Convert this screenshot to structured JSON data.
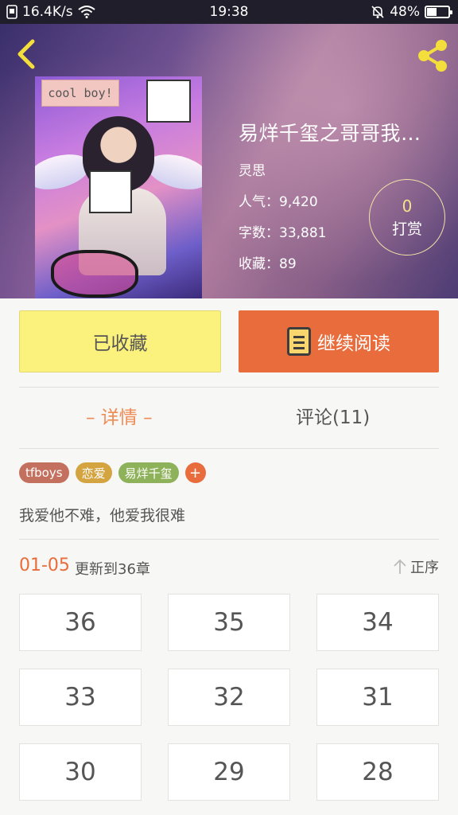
{
  "status_bar": {
    "speed": "16.4K/s",
    "time": "19:38",
    "battery": "48%",
    "battery_level": 0.48
  },
  "book": {
    "title": "易烊千玺之哥哥我…",
    "author": "灵思",
    "popularity_label": "人气：",
    "popularity": "9,420",
    "words_label": "字数：",
    "words": "33,881",
    "favorites_label": "收藏：",
    "favorites": "89",
    "cover_text": "cool boy!",
    "reward_count": "0",
    "reward_label": "打赏"
  },
  "actions": {
    "collected_label": "已收藏",
    "continue_label": "继续阅读"
  },
  "tabs": [
    {
      "label": "– 详情 –",
      "active": true
    },
    {
      "label": "评论(11)",
      "active": false
    }
  ],
  "tags": [
    {
      "label": "tfboys",
      "color": "#c4705e"
    },
    {
      "label": "恋爱",
      "color": "#d4a441"
    },
    {
      "label": "易烊千玺",
      "color": "#8eb25a"
    }
  ],
  "tag_add_label": "+",
  "synopsis": "我爱他不难，他爱我很难",
  "chapters": {
    "range": "01-05",
    "update": "更新到36章",
    "sort_label": "正序",
    "items": [
      "36",
      "35",
      "34",
      "33",
      "32",
      "31",
      "30",
      "29",
      "28"
    ]
  },
  "colors": {
    "accent": "#e86c3c",
    "collected_bg": "#fbf17d",
    "tab_active": "#ef8b55"
  }
}
